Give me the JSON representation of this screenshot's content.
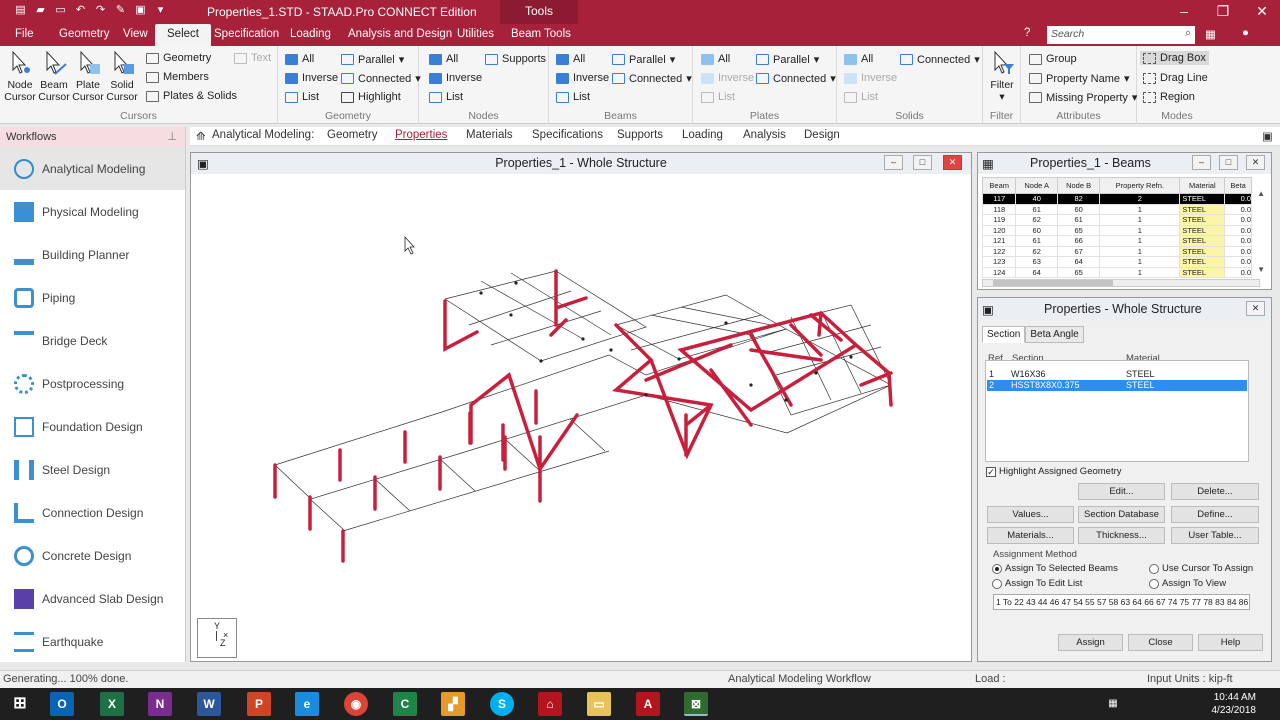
{
  "app": {
    "title": "Properties_1.STD - STAAD.Pro CONNECT Edition",
    "context_tab": "Tools"
  },
  "menu_tabs": [
    "File",
    "Geometry",
    "View",
    "Select",
    "Specification",
    "Loading",
    "Analysis and Design",
    "Utilities",
    "Beam Tools"
  ],
  "search_placeholder": "Search",
  "ribbon": {
    "cursors": {
      "label": "Cursors",
      "node": "Node\nCursor",
      "beam": "Beam\nCursor",
      "plate": "Plate\nCursor",
      "solid": "Solid\nCursor",
      "geometry": "Geometry",
      "members": "Members",
      "plates_solids": "Plates & Solids",
      "text": "Text"
    },
    "geometry": {
      "label": "Geometry",
      "all": "All",
      "inverse": "Inverse",
      "list": "List",
      "parallel": "Parallel",
      "connected": "Connected",
      "highlight": "Highlight"
    },
    "nodes": {
      "label": "Nodes",
      "all": "All",
      "inverse": "Inverse",
      "list": "List",
      "supports": "Supports"
    },
    "beams": {
      "label": "Beams",
      "all": "All",
      "inverse": "Inverse",
      "list": "List",
      "parallel": "Parallel",
      "connected": "Connected"
    },
    "plates": {
      "label": "Plates",
      "all": "All",
      "inverse": "Inverse",
      "list": "List",
      "parallel": "Parallel",
      "connected": "Connected"
    },
    "solids": {
      "label": "Solids",
      "all": "All",
      "inverse": "Inverse",
      "list": "List",
      "connected": "Connected"
    },
    "filter": {
      "label": "Filter",
      "filter": "Filter"
    },
    "attributes": {
      "label": "Attributes",
      "group": "Group",
      "property_name": "Property Name",
      "missing_property": "Missing Property"
    },
    "modes": {
      "label": "Modes",
      "drag_box": "Drag Box",
      "drag_line": "Drag Line",
      "region": "Region"
    }
  },
  "workflows": {
    "header": "Workflows",
    "items": [
      "Analytical Modeling",
      "Physical Modeling",
      "Building Planner",
      "Piping",
      "Bridge Deck",
      "Postprocessing",
      "Foundation Design",
      "Steel Design",
      "Connection Design",
      "Concrete Design",
      "Advanced Slab Design",
      "Earthquake"
    ]
  },
  "subtabs": {
    "prefix": "Analytical Modeling:",
    "items": [
      "Geometry",
      "Properties",
      "Materials",
      "Specifications",
      "Supports",
      "Loading",
      "Analysis",
      "Design"
    ]
  },
  "viewport": {
    "title": "Properties_1 - Whole Structure",
    "axis_y": "Y",
    "axis_z": "Z"
  },
  "beam_table": {
    "title": "Properties_1 - Beams",
    "columns": [
      "Beam",
      "Node A",
      "Node B",
      "Property Refn.",
      "Material",
      "Beta"
    ],
    "rows": [
      [
        "117",
        "40",
        "82",
        "2",
        "STEEL",
        "0.0"
      ],
      [
        "118",
        "61",
        "60",
        "1",
        "STEEL",
        "0.0"
      ],
      [
        "119",
        "62",
        "61",
        "1",
        "STEEL",
        "0.0"
      ],
      [
        "120",
        "60",
        "65",
        "1",
        "STEEL",
        "0.0"
      ],
      [
        "121",
        "61",
        "66",
        "1",
        "STEEL",
        "0.0"
      ],
      [
        "122",
        "62",
        "67",
        "1",
        "STEEL",
        "0.0"
      ],
      [
        "123",
        "63",
        "64",
        "1",
        "STEEL",
        "0.0"
      ],
      [
        "124",
        "64",
        "65",
        "1",
        "STEEL",
        "0.0"
      ]
    ]
  },
  "properties": {
    "title": "Properties - Whole Structure",
    "tabs": [
      "Section",
      "Beta Angle"
    ],
    "col_ref": "Ref",
    "col_section": "Section",
    "col_material": "Material",
    "rows": [
      {
        "ref": "1",
        "section": "W16X36",
        "material": "STEEL"
      },
      {
        "ref": "2",
        "section": "HSST8X8X0.375",
        "material": "STEEL"
      }
    ],
    "highlight_label": "Highlight Assigned Geometry",
    "buttons": {
      "edit": "Edit...",
      "delete": "Delete...",
      "values": "Values...",
      "section_database": "Section Database",
      "define": "Define...",
      "materials": "Materials...",
      "thickness": "Thickness...",
      "user_table": "User Table...",
      "assign": "Assign",
      "close": "Close",
      "help": "Help"
    },
    "assignment_method": "Assignment Method",
    "radio": {
      "selected_beams": "Assign To Selected Beams",
      "cursor": "Use Cursor To Assign",
      "edit_list": "Assign To Edit List",
      "view": "Assign To View"
    },
    "edit_list": "1 To 22 43 44 46 47 54 55 57 58 63 64 66 67 74 75 77 78 83 84 86 8"
  },
  "status": {
    "left": "Generating... 100% done.",
    "workflow": "Analytical Modeling Workflow",
    "load": "Load :",
    "units": "Input Units : kip-ft"
  },
  "clock": {
    "time": "10:44 AM",
    "date": "4/23/2018"
  },
  "colors": {
    "brand": "#a8213a",
    "member_highlight": "#c8203c",
    "selection": "#2d8ef0"
  }
}
